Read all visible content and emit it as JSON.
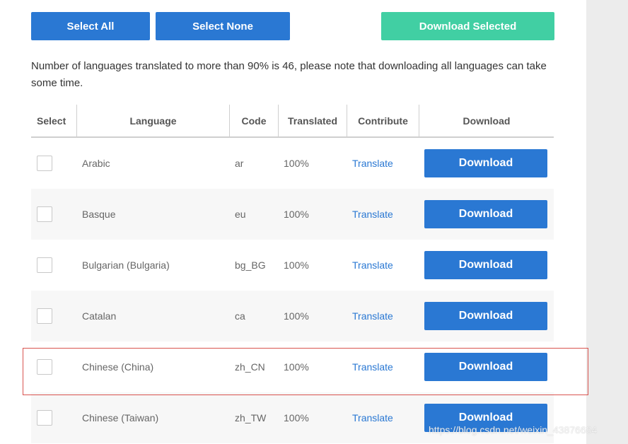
{
  "toolbar": {
    "select_all_label": "Select All",
    "select_none_label": "Select None",
    "download_selected_label": "Download Selected"
  },
  "notice": "Number of languages translated to more than 90% is 46, please note that downloading all languages can take some time.",
  "table": {
    "headers": {
      "select": "Select",
      "language": "Language",
      "code": "Code",
      "translated": "Translated",
      "contribute": "Contribute",
      "download": "Download"
    },
    "rows": [
      {
        "language": "Arabic",
        "code": "ar",
        "translated": "100%",
        "contribute": "Translate",
        "download": "Download",
        "checked": false
      },
      {
        "language": "Basque",
        "code": "eu",
        "translated": "100%",
        "contribute": "Translate",
        "download": "Download",
        "checked": false
      },
      {
        "language": "Bulgarian (Bulgaria)",
        "code": "bg_BG",
        "translated": "100%",
        "contribute": "Translate",
        "download": "Download",
        "checked": false
      },
      {
        "language": "Catalan",
        "code": "ca",
        "translated": "100%",
        "contribute": "Translate",
        "download": "Download",
        "checked": false
      },
      {
        "language": "Chinese (China)",
        "code": "zh_CN",
        "translated": "100%",
        "contribute": "Translate",
        "download": "Download",
        "checked": false
      },
      {
        "language": "Chinese (Taiwan)",
        "code": "zh_TW",
        "translated": "100%",
        "contribute": "Translate",
        "download": "Download",
        "checked": false
      }
    ]
  },
  "watermark": "https://blog.csdn.net/weixin_43876684",
  "colors": {
    "primary_blue": "#2a78d3",
    "accent_green": "#41cfa3",
    "highlight_red": "#d9534f"
  }
}
